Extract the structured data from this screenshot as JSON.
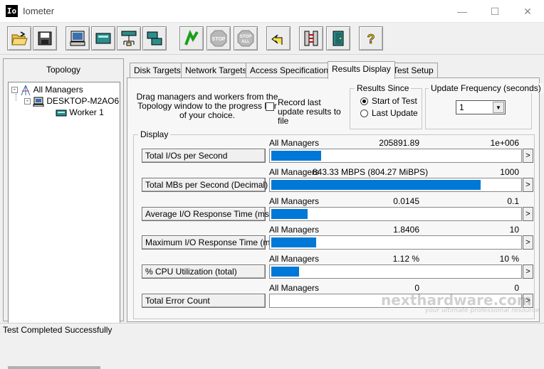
{
  "window": {
    "title": "Iometer",
    "app_icon_text": "Io"
  },
  "toolbar": {
    "buttons": [
      {
        "icon": "open-folder-icon"
      },
      {
        "icon": "save-icon"
      },
      {
        "icon": "display-computer-icon"
      },
      {
        "icon": "new-manager-icon"
      },
      {
        "icon": "network-worker-icon"
      },
      {
        "icon": "copy-worker-icon"
      },
      {
        "icon": "start-green-flag-icon"
      },
      {
        "icon": "stop-icon",
        "label": "STOP"
      },
      {
        "icon": "stop-all-icon",
        "label_top": "STOP",
        "label_bottom": "ALL"
      },
      {
        "icon": "reset-arrow-icon"
      },
      {
        "icon": "disconnect-icon"
      },
      {
        "icon": "exit-door-icon"
      },
      {
        "icon": "help-icon",
        "label": "?"
      }
    ]
  },
  "topology": {
    "title": "Topology",
    "items": [
      {
        "label": "All Managers",
        "expander": "-"
      },
      {
        "label": "DESKTOP-M2AO6",
        "expander": "-"
      },
      {
        "label": "Worker 1"
      }
    ]
  },
  "tabs": [
    "Disk Targets",
    "Network Targets",
    "Access Specifications",
    "Results Display",
    "Test Setup"
  ],
  "results": {
    "instructions": "Drag managers and workers from the Topology window to the progress bar of your choice.",
    "record_label": "Record last update results to file",
    "results_since": {
      "title": "Results Since",
      "options": [
        "Start of Test",
        "Last Update"
      ],
      "selected": "Start of Test"
    },
    "update_frequency": {
      "title": "Update Frequency (seconds)",
      "value": "1"
    },
    "display_title": "Display",
    "metrics": [
      {
        "name": "Total I/Os per Second",
        "source": "All Managers",
        "value": "205891.89",
        "max": "1e+006",
        "fill": 0.2
      },
      {
        "name": "Total MBs per Second (Decimal)",
        "source": "All Managers",
        "value": "843.33 MBPS (804.27 MiBPS)",
        "max": "1000",
        "fill": 0.843
      },
      {
        "name": "Average I/O Response Time (ms)",
        "source": "All Managers",
        "value": "0.0145",
        "max": "0.1",
        "fill": 0.145
      },
      {
        "name": "Maximum I/O Response Time (ms)",
        "source": "All Managers",
        "value": "1.8406",
        "max": "10",
        "fill": 0.18
      },
      {
        "name": "% CPU Utilization (total)",
        "source": "All Managers",
        "value": "1.12 %",
        "max": "10 %",
        "fill": 0.112
      },
      {
        "name": "Total Error Count",
        "source": "All Managers",
        "value": "0",
        "max": "0",
        "fill": 0
      }
    ]
  },
  "status": "Test Completed Successfully",
  "watermark": {
    "brand": "nexthardware.com",
    "tagline": "your ultimate professional resource"
  },
  "colors": {
    "bar": "#0078d7"
  }
}
